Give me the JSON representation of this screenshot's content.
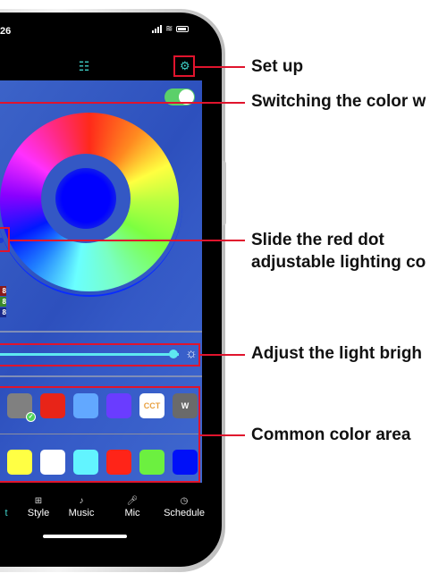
{
  "status_bar": {
    "time": "26",
    "icons": [
      "signal-icon",
      "wifi-icon",
      "battery-icon"
    ]
  },
  "header": {
    "equalizer_icon": "equalizer-icon",
    "settings_icon": "gear-icon"
  },
  "color_panel": {
    "toggle_on": true,
    "rgb_labels": [
      "8",
      "8",
      "8"
    ],
    "brightness_percent": 95
  },
  "presets": {
    "row1": [
      {
        "color": "#808080",
        "label": "",
        "selected": true
      },
      {
        "color": "#e82418",
        "label": "",
        "selected": false
      },
      {
        "color": "#62a8ff",
        "label": "",
        "selected": false
      },
      {
        "color": "#6a3cff",
        "label": "",
        "selected": false
      },
      {
        "color": "#ffffff",
        "label": "CCT",
        "selected": false
      },
      {
        "color": "#6a6a6a",
        "label": "W",
        "selected": false
      }
    ],
    "row2": [
      {
        "color": "#ffff44",
        "label": ""
      },
      {
        "color": "#ffffff",
        "label": ""
      },
      {
        "color": "#62f4ff",
        "label": ""
      },
      {
        "color": "#ff2418",
        "label": ""
      },
      {
        "color": "#6cf040",
        "label": ""
      },
      {
        "color": "#0010f8",
        "label": ""
      }
    ]
  },
  "tabs": [
    {
      "label": "t",
      "icon": "",
      "active": true
    },
    {
      "label": "Style",
      "icon": "grid-icon",
      "active": false
    },
    {
      "label": "Music",
      "icon": "music-note-icon",
      "active": false
    },
    {
      "label": "Mic",
      "icon": "microphone-icon",
      "active": false
    },
    {
      "label": "Schedule",
      "icon": "timer-icon",
      "active": false
    }
  ],
  "annotations": {
    "setup": "Set up",
    "switch_color": "Switching the color w",
    "slide_dot_line1": "Slide the red dot",
    "slide_dot_line2": "adjustable lighting co",
    "brightness": "Adjust the light brigh",
    "common_color": "Common color area"
  },
  "colors": {
    "accent": "#3fd0c8",
    "annotation_red": "#e0142d",
    "panel_blue": "#3458c4"
  }
}
